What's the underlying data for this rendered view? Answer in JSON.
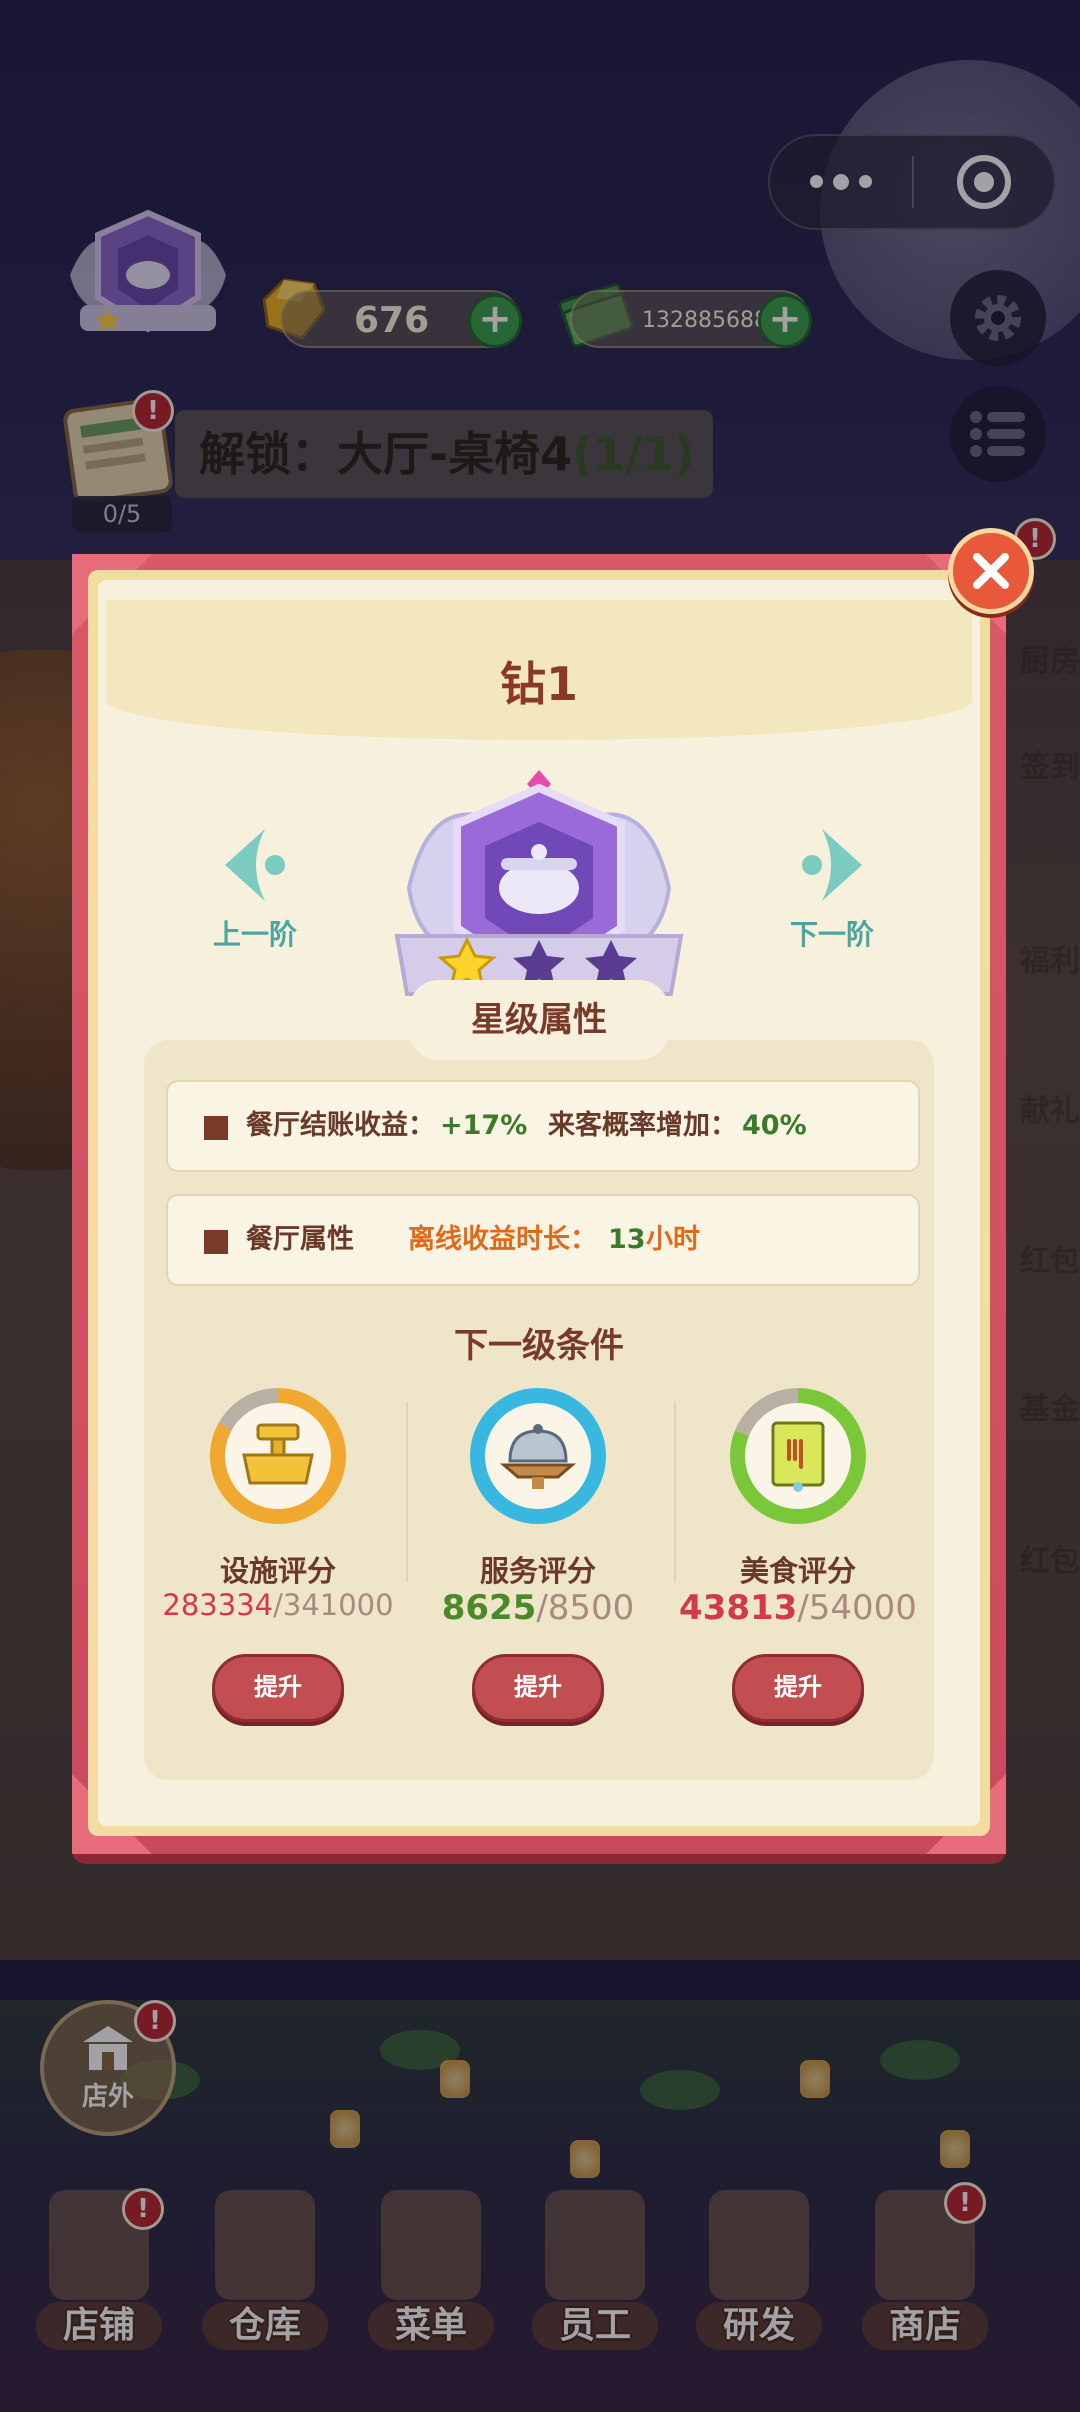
{
  "top": {
    "gold_amount": "676",
    "cash_amount": "132885688",
    "plus_label": "+",
    "unlock_label": "解锁：大厅-桌椅4",
    "unlock_count": "(1/1)",
    "progress": "0/5",
    "notice_badge": "!"
  },
  "side_labels": [
    "厨房",
    "签到",
    "福利",
    "献礼",
    "红包",
    "基金",
    "红包"
  ],
  "modal": {
    "title": "钻1",
    "prev_label": "上一阶",
    "next_label": "下一阶",
    "rank_stars_filled": 1,
    "rank_stars_total": 3,
    "section_title": "星级属性",
    "attr1": {
      "label": "餐厅结账收益",
      "sep": "：",
      "value": "+17%",
      "label2": "来客概率增加",
      "value2": "40%"
    },
    "attr2": {
      "label": "餐厅属性",
      "offline_label": "离线收益时长：",
      "offline_value": "13",
      "offline_unit": "小时"
    },
    "condition_title": "下一级条件",
    "conditions": [
      {
        "label": "设施评分",
        "current": "283334",
        "target": "/341000",
        "button": "提升",
        "ring_color": "#f0a830",
        "progress": 0.831
      },
      {
        "label": "服务评分",
        "current": "8625",
        "target": "/8500",
        "button": "提升",
        "ring_color": "#38b8e0",
        "progress": 1.0
      },
      {
        "label": "美食评分",
        "current": "43813",
        "target": "/54000",
        "button": "提升",
        "ring_color": "#7ac83a",
        "progress": 0.811
      }
    ]
  },
  "bottom": {
    "outside_label": "店外",
    "tabs": [
      "店铺",
      "仓库",
      "菜单",
      "员工",
      "研发",
      "商店"
    ]
  },
  "colors": {
    "frame": "#d85a6a",
    "title": "#8a3a24",
    "nav": "#4ba6a0",
    "button": "#c24e52",
    "green_value": "#3a7a2a",
    "orange_value": "#e06a1a"
  }
}
